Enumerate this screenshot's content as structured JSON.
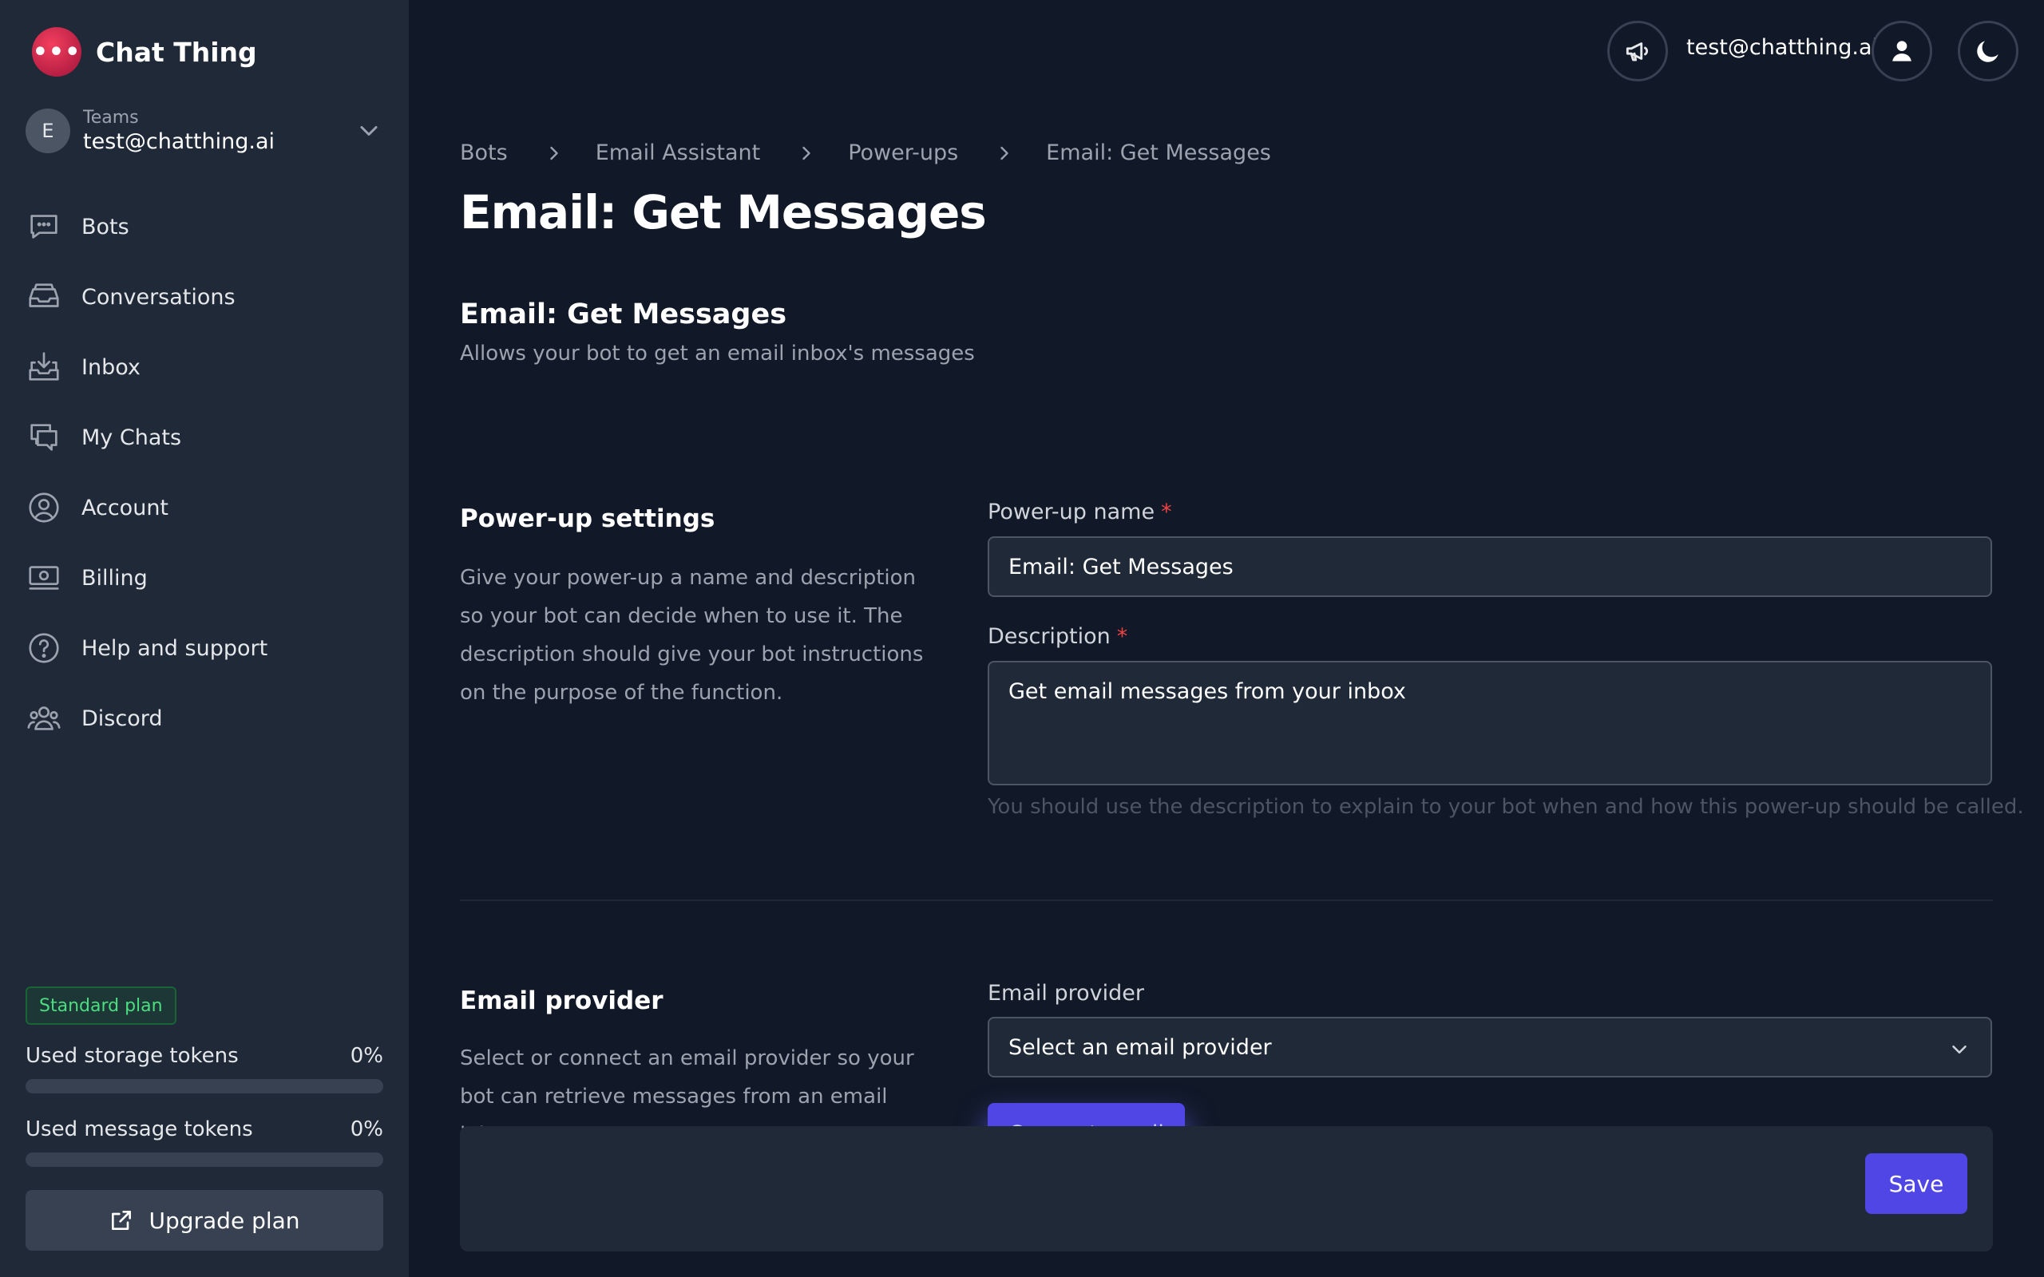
{
  "app": {
    "name": "Chat Thing",
    "logo_glyph": "•••",
    "accent_color": "#4f46e5",
    "brand_color": "#e11d48"
  },
  "team": {
    "avatar_initial": "E",
    "label": "Teams",
    "email": "test@chatthing.ai"
  },
  "nav": {
    "items": [
      {
        "label": "Bots",
        "icon": "chat-bubble-icon"
      },
      {
        "label": "Conversations",
        "icon": "inbox-stack-icon"
      },
      {
        "label": "Inbox",
        "icon": "inbox-download-icon"
      },
      {
        "label": "My Chats",
        "icon": "chat-bubbles-icon"
      },
      {
        "label": "Account",
        "icon": "user-circle-icon"
      },
      {
        "label": "Billing",
        "icon": "banknotes-icon"
      },
      {
        "label": "Help and support",
        "icon": "question-circle-icon"
      },
      {
        "label": "Discord",
        "icon": "user-group-icon"
      }
    ]
  },
  "plan": {
    "badge": "Standard plan",
    "storage": {
      "label": "Used storage tokens",
      "value": "0%",
      "fraction": 0
    },
    "messages": {
      "label": "Used message tokens",
      "value": "0%",
      "fraction": 0
    },
    "upgrade_label": "Upgrade plan"
  },
  "header": {
    "user_email": "test@chatthing.ai"
  },
  "breadcrumb": [
    "Bots",
    "Email Assistant",
    "Power-ups",
    "Email: Get Messages"
  ],
  "page": {
    "title": "Email: Get Messages",
    "subtitle": "Email: Get Messages",
    "subtitle_desc": "Allows your bot to get an email inbox's messages"
  },
  "settings": {
    "title": "Power-up settings",
    "desc": "Give your power-up a name and description so your bot can decide when to use it. The description should give your bot instructions on the purpose of the function.",
    "name_label": "Power-up name",
    "name_value": "Email: Get Messages",
    "desc_label": "Description",
    "desc_value": "Get email messages from your inbox",
    "help": "You should use the description to explain to your bot when and how this power-up should be called.",
    "required_mark": "*"
  },
  "provider": {
    "title": "Email provider",
    "desc": "Select or connect an email provider so your bot can retrieve messages from an email inbox",
    "label": "Email provider",
    "selected": "Select an email provider",
    "connect_label": "Connect email"
  },
  "footer": {
    "save_label": "Save"
  }
}
